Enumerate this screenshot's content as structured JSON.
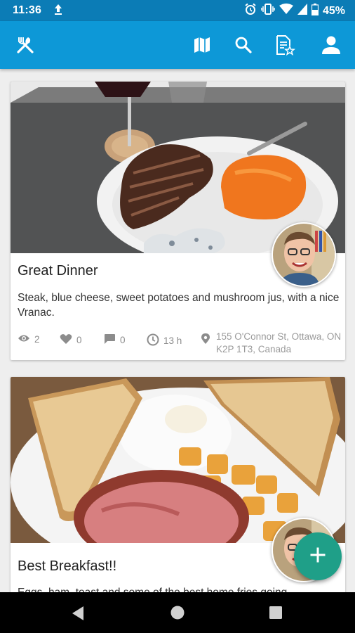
{
  "status_bar": {
    "time": "11:36",
    "battery": "45%"
  },
  "app_bar": {
    "icons": [
      "utensils-icon",
      "map-icon",
      "search-icon",
      "starred-list-icon",
      "profile-icon"
    ]
  },
  "posts": [
    {
      "title": "Great Dinner",
      "description": "Steak, blue cheese, sweet potatoes and mushroom jus, with a nice Vranac.",
      "views": "2",
      "likes": "0",
      "comments": "0",
      "age": "13 h",
      "address": "155 O'Connor St, Ottawa, ON K2P 1T3, Canada"
    },
    {
      "title": "Best Breakfast!!",
      "description": "Eggs, ham, toast and some of the best home fries going"
    }
  ],
  "colors": {
    "status_bar": "#0b7cb6",
    "app_bar": "#0d98d7",
    "fab": "#1f9f88"
  }
}
